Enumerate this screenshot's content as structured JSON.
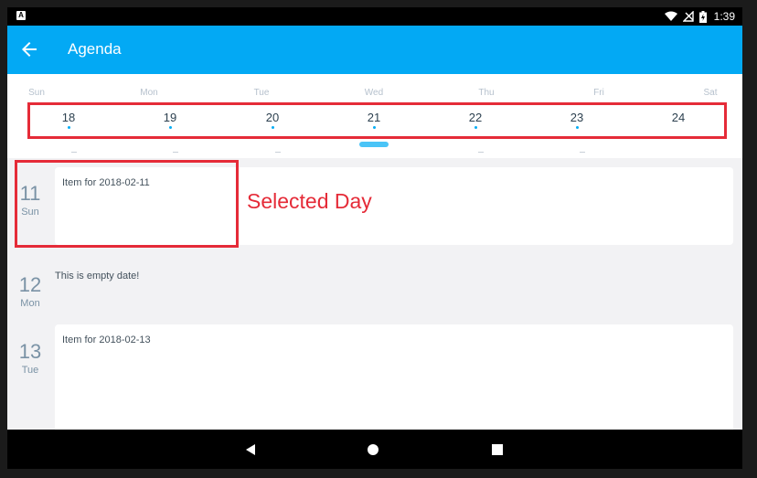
{
  "status_bar": {
    "left_icon": "A",
    "time": "1:39",
    "icons": [
      "wifi-icon",
      "signal-off-icon",
      "battery-charging-icon"
    ]
  },
  "app_bar": {
    "title": "Agenda",
    "back_icon": "arrow-left-icon"
  },
  "week": {
    "days": [
      {
        "dow": "Sun",
        "num": "18"
      },
      {
        "dow": "Mon",
        "num": "19"
      },
      {
        "dow": "Tue",
        "num": "20"
      },
      {
        "dow": "Wed",
        "num": "21"
      },
      {
        "dow": "Thu",
        "num": "22"
      },
      {
        "dow": "Fri",
        "num": "23"
      },
      {
        "dow": "Sat",
        "num": "24"
      }
    ]
  },
  "agenda": [
    {
      "num": "11",
      "dow": "Sun",
      "item": "Item for 2018-02-11"
    },
    {
      "num": "12",
      "dow": "Mon",
      "empty": "This is empty date!"
    },
    {
      "num": "13",
      "dow": "Tue",
      "item": "Item for 2018-02-13"
    }
  ],
  "annotations": {
    "selected_day_label": "Selected Day",
    "color": "#e52b38"
  },
  "colors": {
    "app_bar": "#03a9f4",
    "dot": "#00adf5",
    "knob": "#4ac4f7"
  }
}
